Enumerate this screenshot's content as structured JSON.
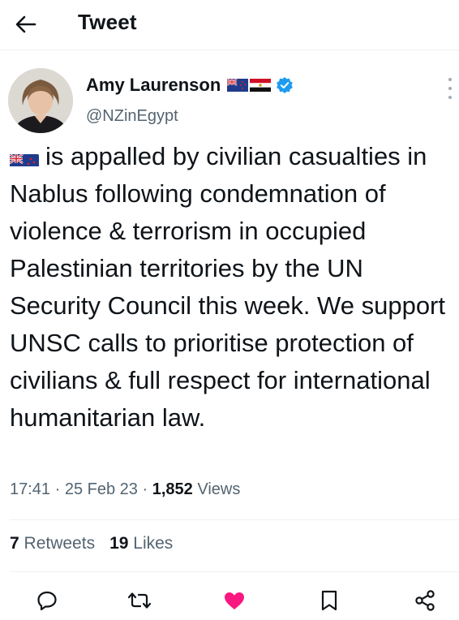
{
  "header": {
    "title": "Tweet",
    "back_icon": "arrow-left-icon"
  },
  "author": {
    "display_name": "Amy Laurenson",
    "handle": "@NZinEgypt",
    "flags": [
      "new-zealand-flag-icon",
      "egypt-flag-icon"
    ],
    "verified_icon": "verified-badge-icon",
    "verified_color": "#1d9bf0"
  },
  "tweet": {
    "lead_flag": "new-zealand-flag-icon",
    "text": "is appalled by civilian casualties in Nablus following condemnation of violence & terrorism in occupied Palestinian territories by the UN Security Council this week. We support UNSC calls to prioritise protection of civilians & full respect for international humanitarian law."
  },
  "meta": {
    "time": "17:41",
    "separator": "·",
    "date": "25 Feb 23",
    "views_count": "1,852",
    "views_label": "Views"
  },
  "stats": {
    "retweets_count": "7",
    "retweets_label": "Retweets",
    "likes_count": "19",
    "likes_label": "Likes"
  },
  "actions": {
    "reply_icon": "reply-icon",
    "retweet_icon": "retweet-icon",
    "like_icon": "heart-icon",
    "like_color": "#f91880",
    "bookmark_icon": "bookmark-icon",
    "share_icon": "share-icon"
  }
}
